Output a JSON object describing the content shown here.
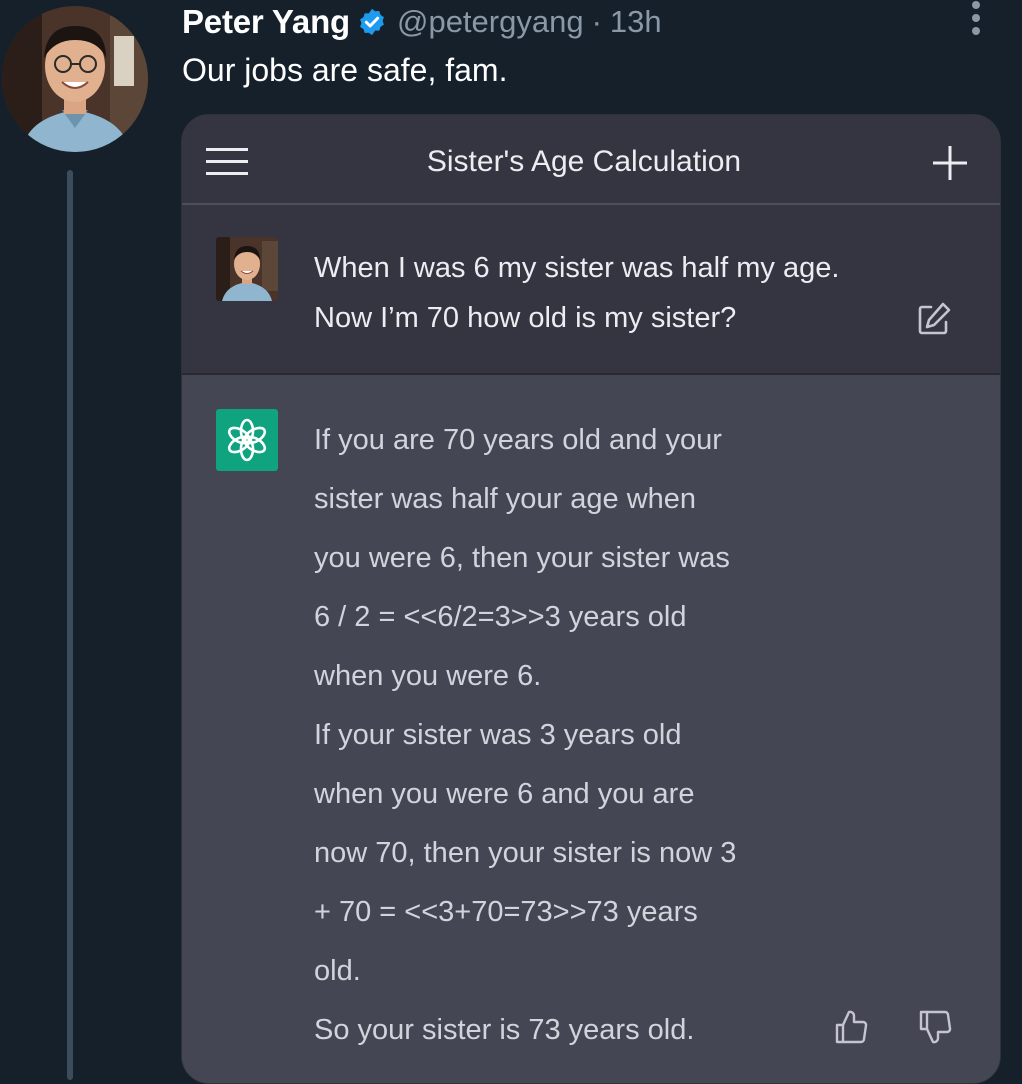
{
  "tweet": {
    "display_name": "Peter Yang",
    "handle": "@petergyang",
    "separator": "·",
    "time": "13h",
    "text": "Our jobs are safe, fam.",
    "verified": true,
    "accent_color": "#1d9bf0"
  },
  "chat": {
    "title": "Sister's Age Calculation",
    "user_message": "When I was 6 my sister was half my age. Now I’m 70 how old is my sister?",
    "assistant_lines": [
      "If you are 70 years old and your",
      "sister was half your age when",
      "you were 6, then your sister was",
      "6 / 2 = <<6/2=3>>3 years old",
      "when you were 6.",
      "If your sister was 3 years old",
      "when you were 6 and you are",
      "now 70, then your sister is now 3",
      "+ 70 = <<3+70=73>>73 years",
      "old.",
      "So your sister is 73 years old."
    ],
    "brand_color": "#10a37f"
  },
  "icons": {
    "verified": "verified-badge-icon",
    "more": "more-vertical-icon",
    "menu": "hamburger-menu-icon",
    "new_chat": "plus-icon",
    "edit": "edit-icon",
    "assistant": "openai-logo-icon",
    "like": "thumbs-up-icon",
    "dislike": "thumbs-down-icon"
  }
}
